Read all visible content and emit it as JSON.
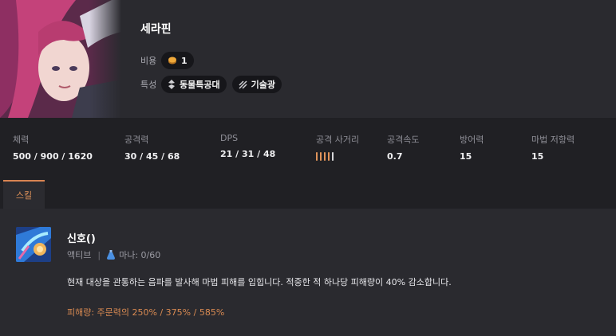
{
  "champion": {
    "name": "세라핀",
    "cost_label": "비용",
    "cost_value": "1",
    "traits_label": "특성",
    "traits": [
      "동물특공대",
      "기술광"
    ]
  },
  "stats": [
    {
      "label": "체력",
      "value": "500 / 900 / 1620"
    },
    {
      "label": "공격력",
      "value": "30 / 45 / 68"
    },
    {
      "label": "DPS",
      "value": "21 / 31 / 48"
    },
    {
      "label": "공격 사거리",
      "value": null,
      "range_filled": 4,
      "range_total": 5
    },
    {
      "label": "공격속도",
      "value": "0.7"
    },
    {
      "label": "방어력",
      "value": "15"
    },
    {
      "label": "마법 저항력",
      "value": "15"
    }
  ],
  "tabs": [
    {
      "label": "스킬",
      "active": true
    }
  ],
  "skill": {
    "name": "신호()",
    "type": "액티브",
    "separator": "|",
    "mana": "마나: 0/60",
    "description": "현재 대상을 관통하는 음파를 발사해 마법 피해를 입힙니다. 적중한 적 하나당 피해량이 40% 감소합니다.",
    "damage": "피해량: 주문력의 250% / 375% / 585%"
  },
  "colors": {
    "accent": "#e0935a",
    "background": "#202024",
    "panel": "#2a2a2f"
  },
  "icons": {
    "cost": "coin-icon",
    "trait1": "animal-squad-icon",
    "trait2": "techie-icon",
    "mana": "mana-flask-icon"
  }
}
